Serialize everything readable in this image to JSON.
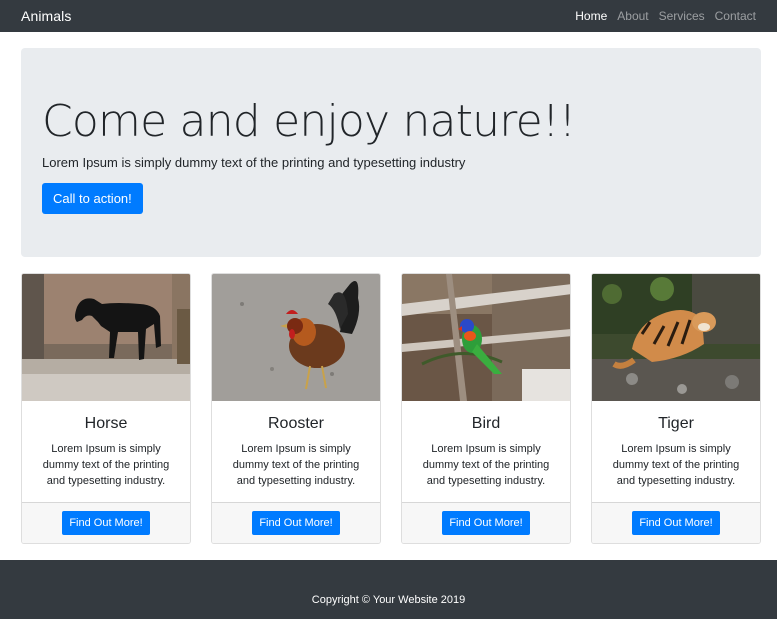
{
  "navbar": {
    "brand": "Animals",
    "links": [
      {
        "label": "Home",
        "active": true
      },
      {
        "label": "About",
        "active": false
      },
      {
        "label": "Services",
        "active": false
      },
      {
        "label": "Contact",
        "active": false
      }
    ]
  },
  "hero": {
    "title": "Come and enjoy nature!!",
    "lead": "Lorem Ipsum is simply dummy text of the printing and typesetting industry",
    "cta_label": "Call to action!"
  },
  "cards": [
    {
      "title": "Horse",
      "text": "Lorem Ipsum is simply dummy text of the printing and typesetting industry.",
      "button": "Find Out More!",
      "image": "horse-photo"
    },
    {
      "title": "Rooster",
      "text": "Lorem Ipsum is simply dummy text of the printing and typesetting industry.",
      "button": "Find Out More!",
      "image": "rooster-photo"
    },
    {
      "title": "Bird",
      "text": "Lorem Ipsum is simply dummy text of the printing and typesetting industry.",
      "button": "Find Out More!",
      "image": "parrot-photo"
    },
    {
      "title": "Tiger",
      "text": "Lorem Ipsum is simply dummy text of the printing and typesetting industry.",
      "button": "Find Out More!",
      "image": "tiger-photo"
    }
  ],
  "footer": {
    "copyright": "Copyright © Your Website 2019"
  },
  "colors": {
    "navbar_bg": "#343a40",
    "primary": "#007bff",
    "jumbotron_bg": "#e9ecef",
    "card_footer_bg": "#f7f7f7"
  }
}
